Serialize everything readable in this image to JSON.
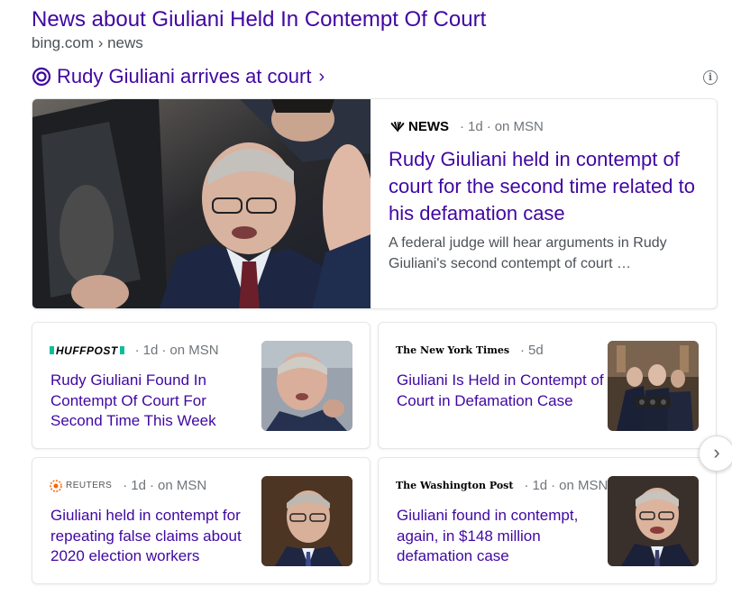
{
  "header": {
    "title": "News about Giuliani Held In Contempt Of Court",
    "url": "bing.com › news"
  },
  "topic": {
    "label": "Rudy Giuliani arrives at court",
    "chevron": "›",
    "icon": "topic-ring-icon"
  },
  "info_icon": "i",
  "hero": {
    "source_logo": "NEWS",
    "age": "1d",
    "platform": "on MSN",
    "headline": "Rudy Giuliani held in contempt of court for the second time related to his defamation case",
    "snippet": "A federal judge will hear arguments in Rudy Giuliani's second contempt of court …"
  },
  "cards": [
    {
      "source_logo": "HUFFPOST",
      "age": "1d",
      "platform": "on MSN",
      "headline": "Rudy Giuliani Found In Contempt Of Court For Second Time This Week"
    },
    {
      "source_logo": "The New York Times",
      "age": "5d",
      "platform": "",
      "headline": "Giuliani Is Held in Contempt of Court in Defamation Case"
    },
    {
      "source_logo": "REUTERS",
      "age": "1d",
      "platform": "on MSN",
      "headline": "Giuliani held in contempt for repeating false claims about 2020 election workers"
    },
    {
      "source_logo": "The Washington Post",
      "age": "1d",
      "platform": "on MSN",
      "headline": "Giuliani found in contempt, again, in $148 million defamation case"
    }
  ],
  "separator": "·",
  "next_button": "›",
  "colors": {
    "visited_link": "#4007a2",
    "meta_text": "#70757a",
    "snippet_text": "#4d5156",
    "huffpost_green": "#0dbe98",
    "reuters_orange": "#fa6400"
  }
}
